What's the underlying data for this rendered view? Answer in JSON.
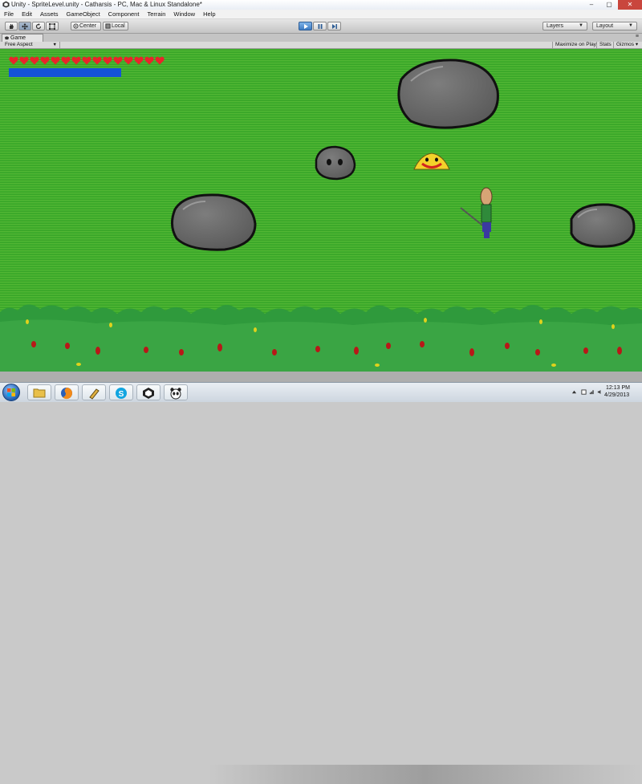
{
  "window": {
    "title": "Unity - SpriteLevel.unity - Catharsis - PC, Mac & Linux Standalone*",
    "minimize": "–",
    "maximize": "▢",
    "close": "✕"
  },
  "menu": [
    "File",
    "Edit",
    "Assets",
    "GameObject",
    "Component",
    "Terrain",
    "Window",
    "Help"
  ],
  "toolbar": {
    "pivot_label": "Center",
    "space_label": "Local",
    "layers_label": "Layers",
    "layout_label": "Layout"
  },
  "game_tab": {
    "tab_label": "Game",
    "aspect_label": "Free Aspect",
    "maximize_label": "Maximize on Play",
    "stats_label": "Stats",
    "gizmos_label": "Gizmos"
  },
  "hud": {
    "hearts": 15,
    "health_fill": 1.0,
    "heart_color": "#e8242b",
    "bar_color": "#1452d8"
  },
  "taskbar": {
    "pinned": [
      "explorer-icon",
      "firefox-icon",
      "unity-editor-icon",
      "skype-icon",
      "unity-icon",
      "panda-icon"
    ],
    "time": "12:13 PM",
    "date": "4/29/2013"
  },
  "colors": {
    "grass": "#3fae2c",
    "rock": "#6b6b6b",
    "slime": "#f3d22a"
  }
}
